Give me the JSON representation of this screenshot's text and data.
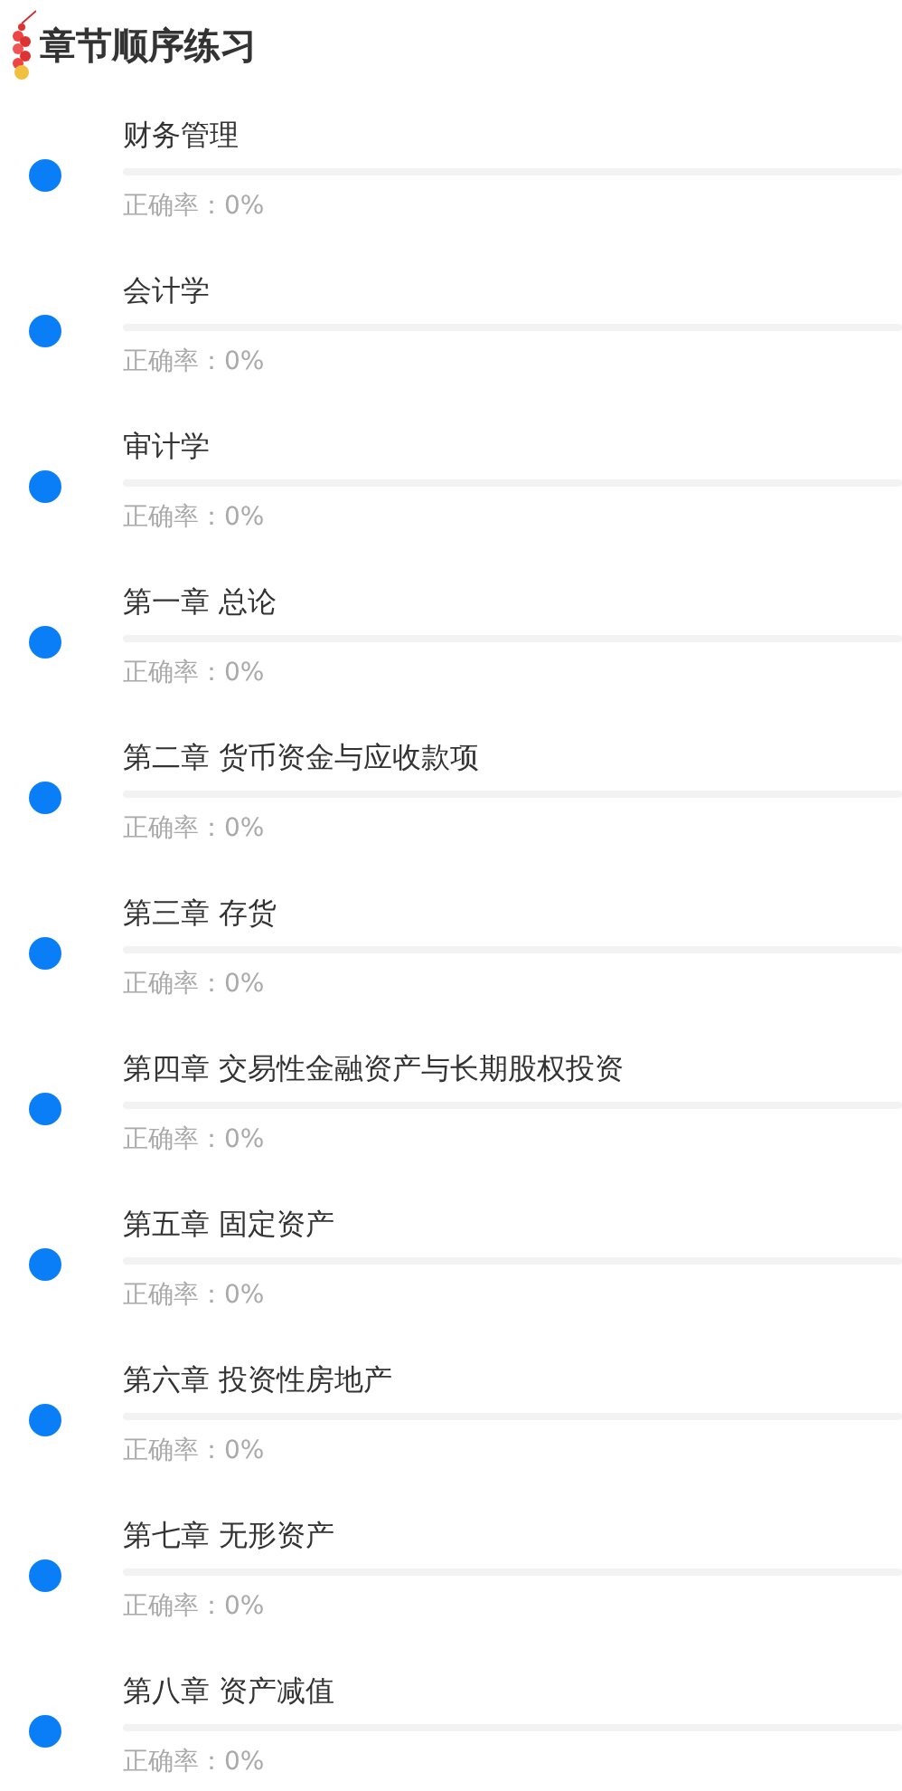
{
  "header": {
    "title": "章节顺序练习"
  },
  "chapters": [
    {
      "name": "财务管理",
      "level": 0,
      "accuracy": "正确率：0%"
    },
    {
      "name": "会计学",
      "level": 0,
      "accuracy": "正确率：0%"
    },
    {
      "name": "审计学",
      "level": 0,
      "accuracy": "正确率：0%"
    },
    {
      "name": "第一章 总论",
      "level": 0,
      "accuracy": "正确率：0%"
    },
    {
      "name": "第二章 货币资金与应收款项",
      "level": 0,
      "accuracy": "正确率：0%"
    },
    {
      "name": "第三章 存货",
      "level": 0,
      "accuracy": "正确率：0%"
    },
    {
      "name": "第四章 交易性金融资产与长期股权投资",
      "level": 0,
      "accuracy": "正确率：0%"
    },
    {
      "name": "第五章 固定资产",
      "level": 0,
      "accuracy": "正确率：0%"
    },
    {
      "name": "第六章 投资性房地产",
      "level": 0,
      "accuracy": "正确率：0%"
    },
    {
      "name": "第七章 无形资产",
      "level": 0,
      "accuracy": "正确率：0%"
    },
    {
      "name": "第八章 资产减值",
      "level": 0,
      "accuracy": "正确率：0%"
    }
  ]
}
